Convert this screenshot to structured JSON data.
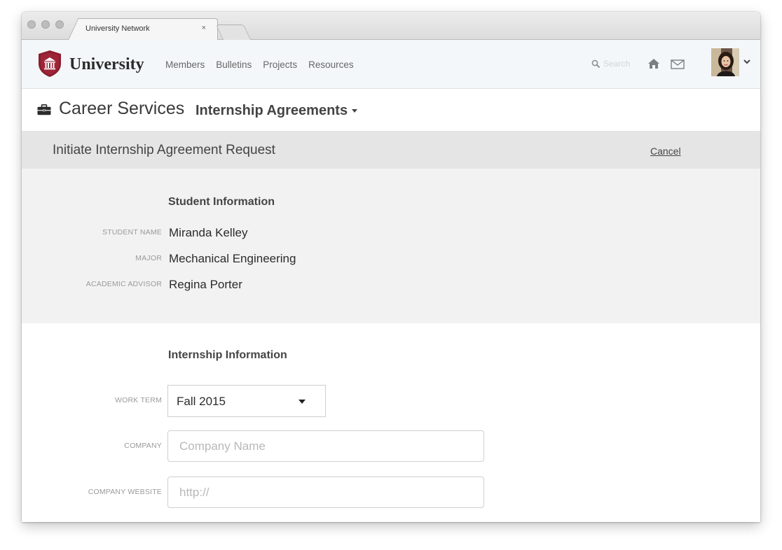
{
  "browser": {
    "tab_title": "University Network",
    "tab_close": "×"
  },
  "header": {
    "brand": "University",
    "nav": [
      "Members",
      "Bulletins",
      "Projects",
      "Resources"
    ],
    "search_placeholder": "Search",
    "brand_color": "#8b1e2d"
  },
  "section": {
    "title": "Career Services",
    "subtitle": "Internship Agreements"
  },
  "page": {
    "title": "Initiate Internship Agreement Request",
    "cancel_label": "Cancel"
  },
  "student_info": {
    "heading": "Student Information",
    "fields": [
      {
        "label": "STUDENT NAME",
        "value": "Miranda Kelley"
      },
      {
        "label": "MAJOR",
        "value": "Mechanical Engineering"
      },
      {
        "label": "ACADEMIC ADVISOR",
        "value": "Regina Porter"
      }
    ]
  },
  "internship_info": {
    "heading": "Internship Information",
    "work_term_label": "WORK TERM",
    "work_term_value": "Fall 2015",
    "company_label": "COMPANY",
    "company_placeholder": "Company Name",
    "website_label": "COMPANY WEBSITE",
    "website_placeholder": "http://"
  }
}
